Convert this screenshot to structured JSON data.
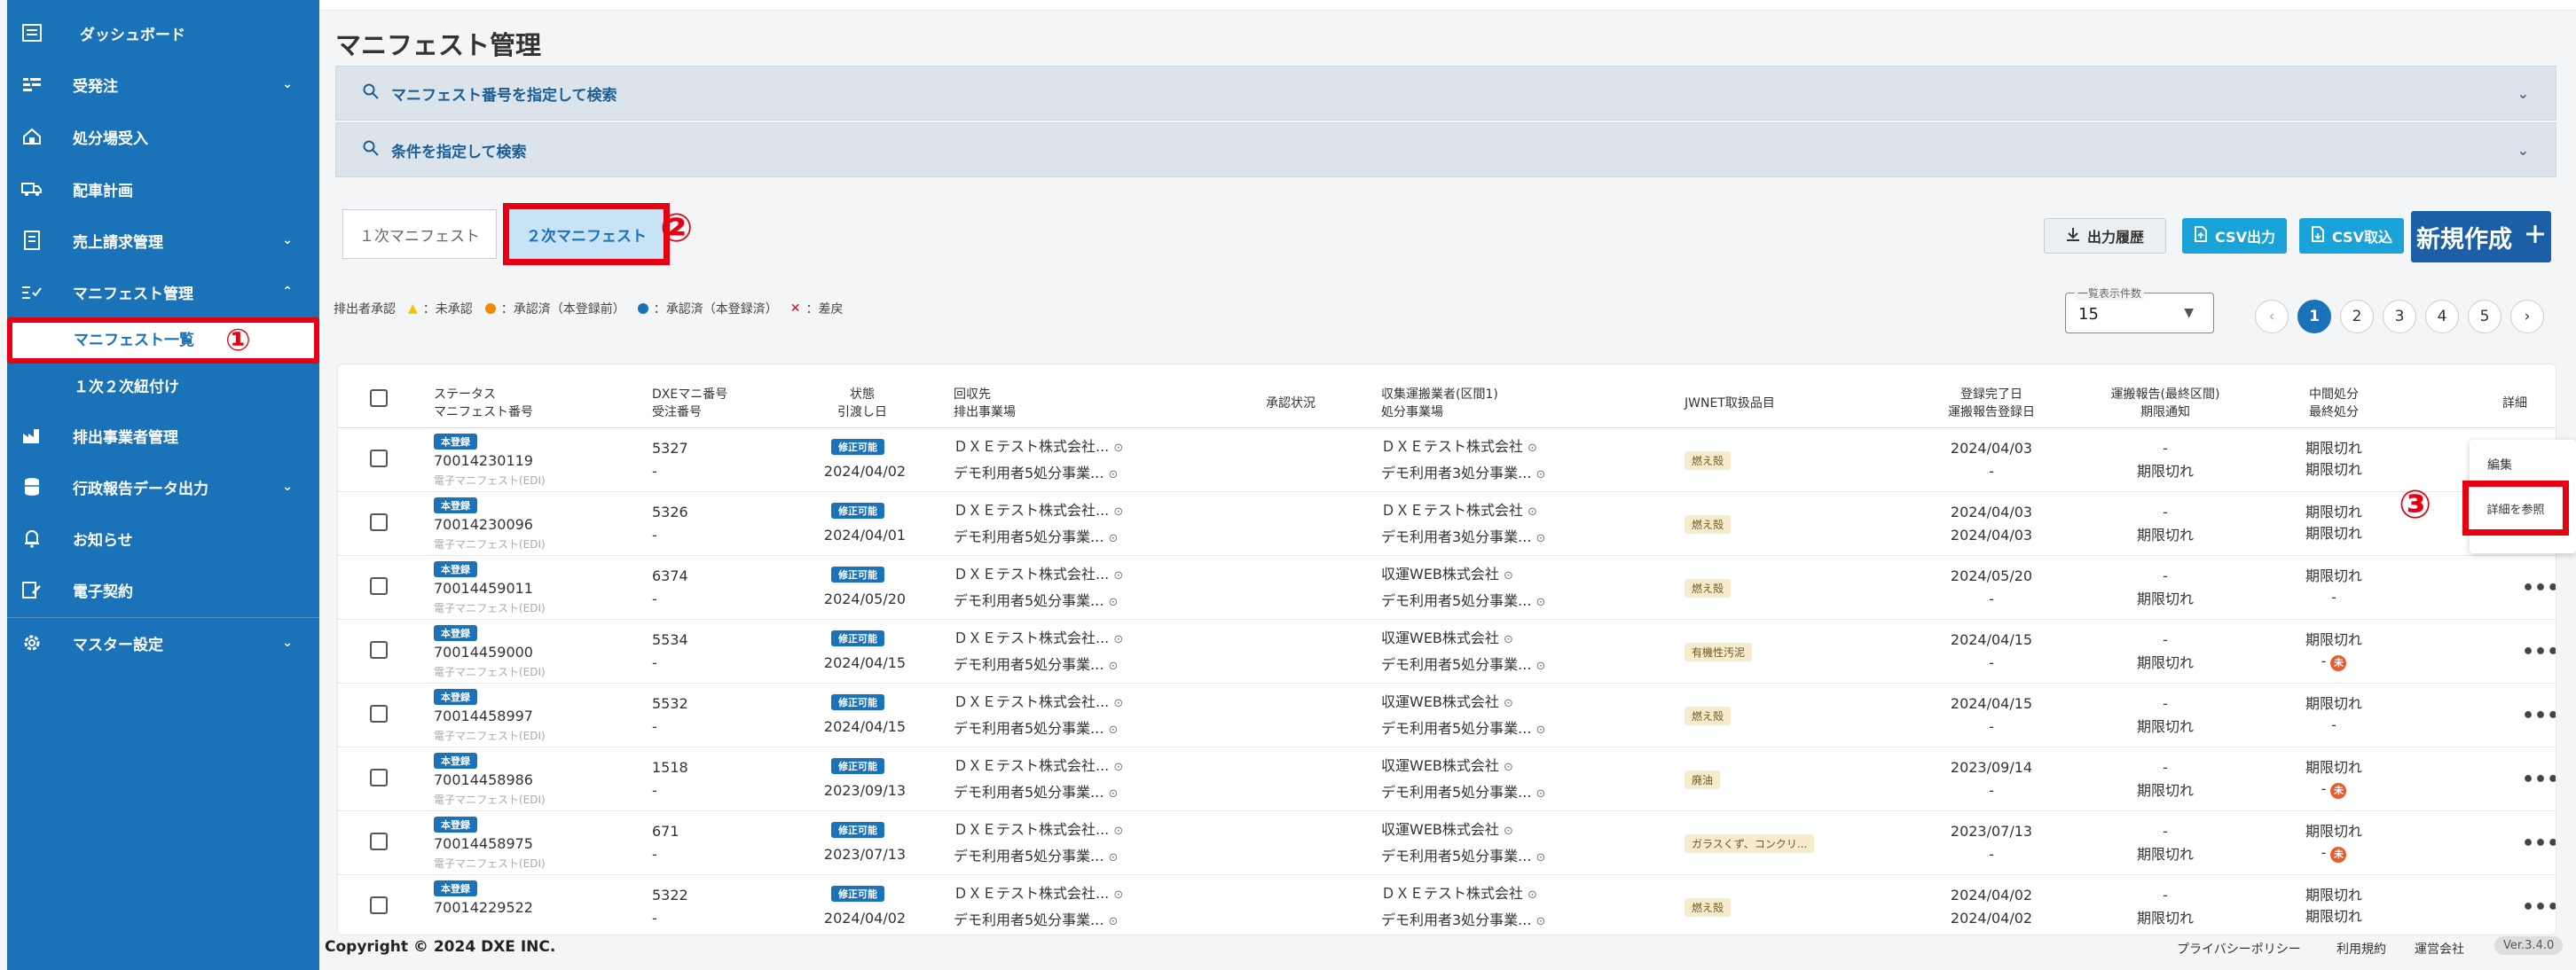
{
  "sidebar": {
    "items": [
      {
        "label": "ダッシュボード",
        "icon": "dashboard-icon",
        "chevron": ""
      },
      {
        "label": "受発注",
        "icon": "order-icon",
        "chevron": "⌄"
      },
      {
        "label": "処分場受入",
        "icon": "facility-icon",
        "chevron": ""
      },
      {
        "label": "配車計画",
        "icon": "truck-icon",
        "chevron": ""
      },
      {
        "label": "売上請求管理",
        "icon": "invoice-icon",
        "chevron": "⌄"
      },
      {
        "label": "マニフェスト管理",
        "icon": "checklist-icon",
        "chevron": "⌃"
      },
      {
        "label": "排出事業者管理",
        "icon": "factory-icon",
        "chevron": ""
      },
      {
        "label": "行政報告データ出力",
        "icon": "database-icon",
        "chevron": "⌄"
      },
      {
        "label": "お知らせ",
        "icon": "bell-icon",
        "chevron": ""
      },
      {
        "label": "電子契約",
        "icon": "contract-icon",
        "chevron": ""
      },
      {
        "label": "マスター設定",
        "icon": "gear-icon",
        "chevron": "⌄"
      }
    ],
    "sub_items": [
      {
        "label": "マニフェスト一覧"
      },
      {
        "label": "１次２次紐付け"
      }
    ]
  },
  "annotations": {
    "one": "①",
    "two": "②",
    "three": "③"
  },
  "page": {
    "title": "マニフェスト管理"
  },
  "search": {
    "by_number": "マニフェスト番号を指定して検索",
    "by_condition": "条件を指定して検索"
  },
  "tabs": [
    "１次マニフェスト",
    "２次マニフェスト"
  ],
  "toolbar": {
    "history": "出力履歴",
    "csv_out": "CSV出力",
    "csv_in": "CSV取込",
    "new": "新規作成"
  },
  "legend": {
    "title": "排出者承認",
    "unapproved": "：未承認",
    "approved_unreg": "：承認済（本登録前）",
    "approved_reg": "：承認済（本登録済）",
    "rejected": "：差戻"
  },
  "colors": {
    "primary": "#1a72b8",
    "highlight": "#e60012",
    "warn_yellow": "#f2c200",
    "warn_orange": "#f08a00"
  },
  "page_size": {
    "label": "一覧表示件数",
    "value": "15"
  },
  "pager": {
    "pages": [
      "1",
      "2",
      "3",
      "4",
      "5"
    ],
    "current": "1"
  },
  "table": {
    "headers": {
      "status": "ステータス",
      "manifest_no": "マニフェスト番号",
      "dxe_no": "DXEマニ番号",
      "order_no": "受注番号",
      "state": "状態",
      "handover": "引渡し日",
      "collector": "回収先",
      "emitter_site": "排出事業場",
      "approval": "承認状況",
      "transporter": "収集運搬業者(区間1)",
      "disposal_site": "処分事業場",
      "jwnet": "JWNET取扱品目",
      "reg_done": "登録完了日",
      "transport_report": "運搬報告登録日",
      "report_last": "運搬報告(最終区間)",
      "deadline": "期限通知",
      "mid_disposal": "中間処分",
      "final_disposal": "最終処分",
      "detail": "詳細"
    },
    "rows": [
      {
        "status": "本登録",
        "no": "70014230119",
        "sub": "電子マニフェスト(EDI)",
        "dxe": "5327",
        "order": "-",
        "state": "修正可能",
        "date": "2024/04/02",
        "collector": "ＤＸＥテスト株式会社...",
        "emitter": "デモ利用者5処分事業...",
        "approval": "",
        "transporter": "ＤＸＥテスト株式会社",
        "disposal": "デモ利用者3処分事業...",
        "jwnet": "燃え殻",
        "reg": "2024/04/03",
        "report": "-",
        "last": "-",
        "deadline": "期限切れ",
        "mid": "期限切れ",
        "final": "期限切れ",
        "final_warn": false
      },
      {
        "status": "本登録",
        "no": "70014230096",
        "sub": "電子マニフェスト(EDI)",
        "dxe": "5326",
        "order": "-",
        "state": "修正可能",
        "date": "2024/04/01",
        "collector": "ＤＸＥテスト株式会社...",
        "emitter": "デモ利用者5処分事業...",
        "approval": "",
        "transporter": "ＤＸＥテスト株式会社",
        "disposal": "デモ利用者3処分事業...",
        "jwnet": "燃え殻",
        "reg": "2024/04/03",
        "report": "2024/04/03",
        "last": "-",
        "deadline": "期限切れ",
        "mid": "期限切れ",
        "final": "期限切れ",
        "final_warn": false
      },
      {
        "status": "本登録",
        "no": "70014459011",
        "sub": "電子マニフェスト(EDI)",
        "dxe": "6374",
        "order": "-",
        "state": "修正可能",
        "date": "2024/05/20",
        "collector": "ＤＸＥテスト株式会社...",
        "emitter": "デモ利用者5処分事業...",
        "approval": "",
        "transporter": "収運WEB株式会社",
        "disposal": "デモ利用者5処分事業...",
        "jwnet": "燃え殻",
        "reg": "2024/05/20",
        "report": "-",
        "last": "-",
        "deadline": "期限切れ",
        "mid": "期限切れ",
        "final": "-",
        "final_warn": false
      },
      {
        "status": "本登録",
        "no": "70014459000",
        "sub": "電子マニフェスト(EDI)",
        "dxe": "5534",
        "order": "-",
        "state": "修正可能",
        "date": "2024/04/15",
        "collector": "ＤＸＥテスト株式会社...",
        "emitter": "デモ利用者5処分事業...",
        "approval": "",
        "transporter": "収運WEB株式会社",
        "disposal": "デモ利用者5処分事業...",
        "jwnet": "有機性汚泥",
        "reg": "2024/04/15",
        "report": "-",
        "last": "-",
        "deadline": "期限切れ",
        "mid": "期限切れ",
        "final": "-",
        "final_warn": true
      },
      {
        "status": "本登録",
        "no": "70014458997",
        "sub": "電子マニフェスト(EDI)",
        "dxe": "5532",
        "order": "-",
        "state": "修正可能",
        "date": "2024/04/15",
        "collector": "ＤＸＥテスト株式会社...",
        "emitter": "デモ利用者5処分事業...",
        "approval": "",
        "transporter": "収運WEB株式会社",
        "disposal": "デモ利用者5処分事業...",
        "jwnet": "燃え殻",
        "reg": "2024/04/15",
        "report": "-",
        "last": "-",
        "deadline": "期限切れ",
        "mid": "期限切れ",
        "final": "-",
        "final_warn": false
      },
      {
        "status": "本登録",
        "no": "70014458986",
        "sub": "電子マニフェスト(EDI)",
        "dxe": "1518",
        "order": "-",
        "state": "修正可能",
        "date": "2023/09/13",
        "collector": "ＤＸＥテスト株式会社...",
        "emitter": "デモ利用者5処分事業...",
        "approval": "",
        "transporter": "収運WEB株式会社",
        "disposal": "デモ利用者5処分事業...",
        "jwnet": "廃油",
        "reg": "2023/09/14",
        "report": "-",
        "last": "-",
        "deadline": "期限切れ",
        "mid": "期限切れ",
        "final": "-",
        "final_warn": true
      },
      {
        "status": "本登録",
        "no": "70014458975",
        "sub": "電子マニフェスト(EDI)",
        "dxe": "671",
        "order": "-",
        "state": "修正可能",
        "date": "2023/07/13",
        "collector": "ＤＸＥテスト株式会社...",
        "emitter": "デモ利用者5処分事業...",
        "approval": "",
        "transporter": "収運WEB株式会社",
        "disposal": "デモ利用者5処分事業...",
        "jwnet": "ガラスくず、コンクリ...",
        "reg": "2023/07/13",
        "report": "-",
        "last": "-",
        "deadline": "期限切れ",
        "mid": "期限切れ",
        "final": "-",
        "final_warn": true
      },
      {
        "status": "本登録",
        "no": "70014229522",
        "sub": "",
        "dxe": "5322",
        "order": "-",
        "state": "修正可能",
        "date": "2024/04/02",
        "collector": "ＤＸＥテスト株式会社...",
        "emitter": "デモ利用者5処分事業...",
        "approval": "",
        "transporter": "ＤＸＥテスト株式会社",
        "disposal": "デモ利用者3処分事業...",
        "jwnet": "燃え殻",
        "reg": "2024/04/02",
        "report": "2024/04/02",
        "last": "-",
        "deadline": "期限切れ",
        "mid": "期限切れ",
        "final": "期限切れ",
        "final_warn": false
      }
    ]
  },
  "row_menu": {
    "edit": "編集",
    "detail": "詳細を参照",
    "more": "•••"
  },
  "warn_glyph": "未",
  "footer": {
    "copyright": "Copyright © 2024 DXE INC.",
    "privacy": "プライバシーポリシー",
    "terms": "利用規約",
    "company": "運営会社",
    "version": "Ver.3.4.0"
  }
}
